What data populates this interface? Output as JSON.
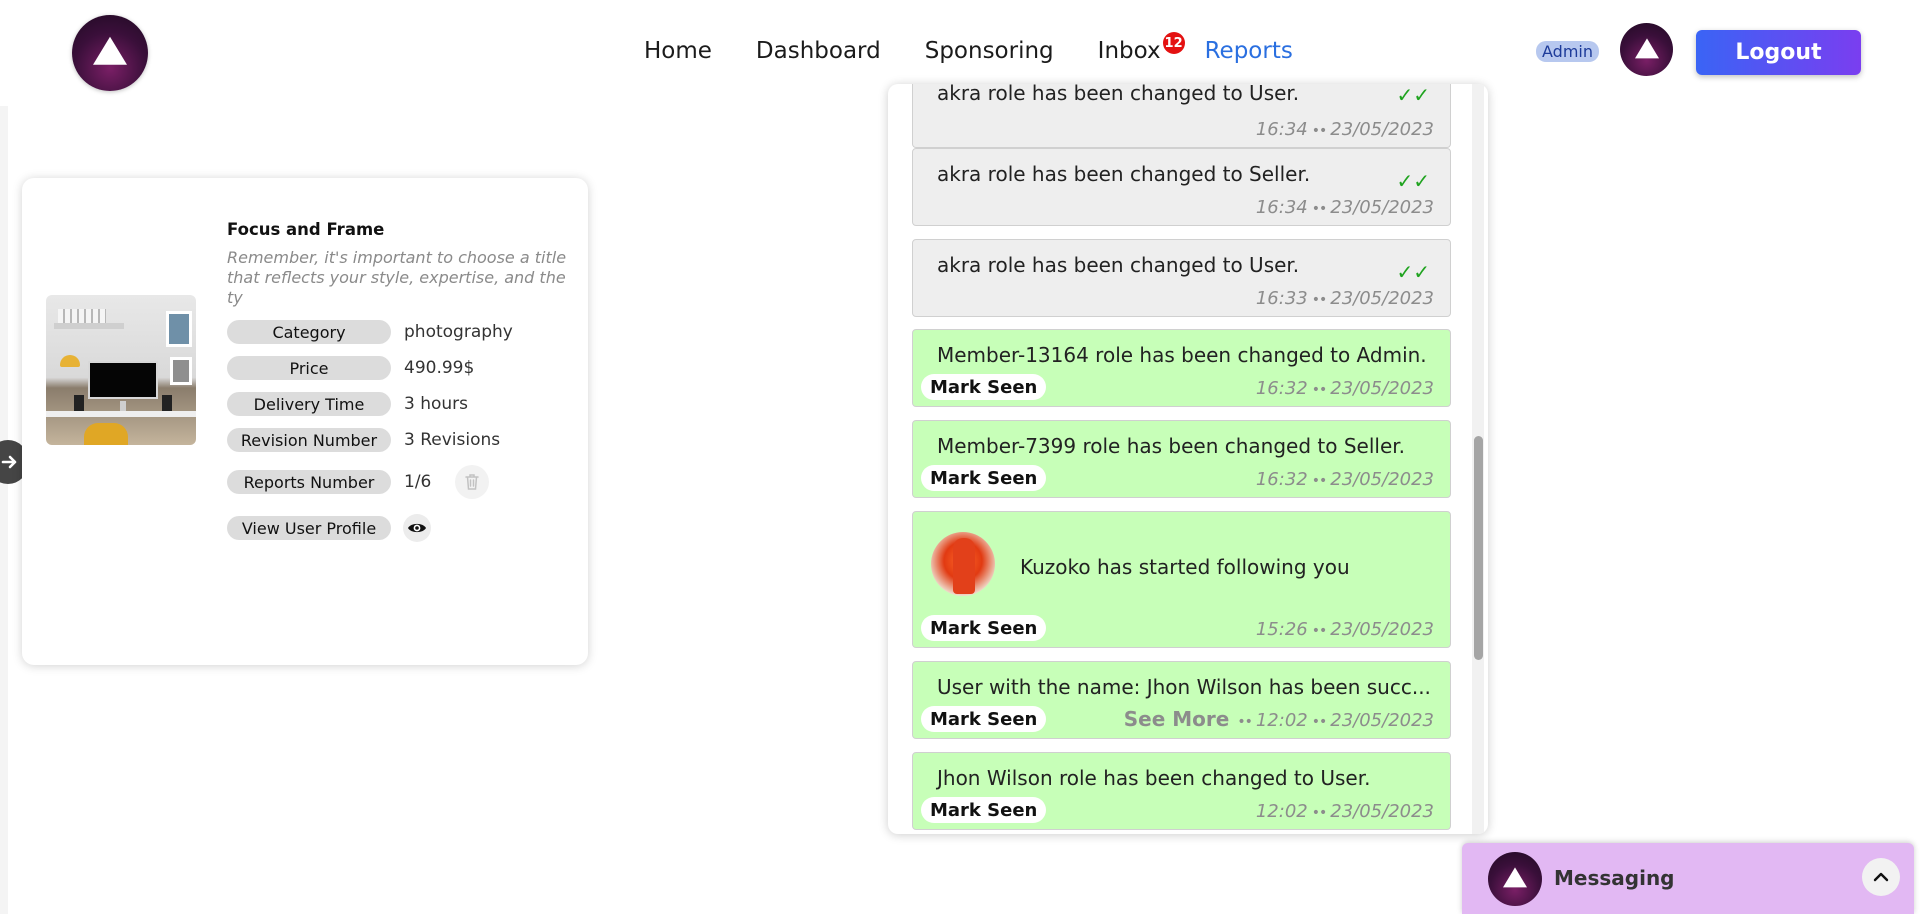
{
  "navbar": {
    "links": [
      {
        "label": "Home"
      },
      {
        "label": "Dashboard"
      },
      {
        "label": "Sponsoring"
      },
      {
        "label": "Inbox",
        "badge": "12"
      },
      {
        "label": "Reports",
        "active": true
      }
    ],
    "role_badge": "Admin",
    "logout_label": "Logout",
    "accent_color": "#2a6fe0"
  },
  "side_toggle": {
    "icon": "arrow-right-icon"
  },
  "card": {
    "title": "Focus and Frame",
    "description": "Remember, it's important to choose a title that reflects your style, expertise, and the ty",
    "details": [
      {
        "label": "Category",
        "value": "photography"
      },
      {
        "label": "Price",
        "value": "490.99$"
      },
      {
        "label": "Delivery Time",
        "value": "3 hours"
      },
      {
        "label": "Revision Number",
        "value": "3 Revisions"
      },
      {
        "label": "Reports Number",
        "value": "1/6"
      },
      {
        "label": "View User Profile"
      }
    ]
  },
  "notifications": [
    {
      "message": "akra role has been changed to User.",
      "time": "16:34",
      "date": "23/05/2023",
      "read": true
    },
    {
      "message": "akra role has been changed to Seller.",
      "time": "16:34",
      "date": "23/05/2023",
      "read": true
    },
    {
      "message": "akra role has been changed to User.",
      "time": "16:33",
      "date": "23/05/2023",
      "read": true
    },
    {
      "message": "Member-13164 role has been changed to Admin.",
      "time": "16:32",
      "date": "23/05/2023",
      "read": false
    },
    {
      "message": "Member-7399 role has been changed to Seller.",
      "time": "16:32",
      "date": "23/05/2023",
      "read": false
    },
    {
      "message": "Kuzoko has started following you",
      "time": "15:26",
      "date": "23/05/2023",
      "read": false
    },
    {
      "message": "User with the name: Jhon Wilson has been succ...",
      "time": "12:02",
      "date": "23/05/2023",
      "read": false,
      "see_more": "See More"
    },
    {
      "message": "Jhon Wilson role has been changed to User.",
      "time": "12:02",
      "date": "23/05/2023",
      "read": false
    }
  ],
  "mark_seen_label": "Mark Seen",
  "meta_separator": "••",
  "messaging": {
    "label": "Messaging"
  },
  "colors": {
    "unread_bg": "#c7ffb8",
    "read_bg": "#eeeeee",
    "messaging_bg": "#e2b8f3",
    "check": "#1fa31f"
  }
}
